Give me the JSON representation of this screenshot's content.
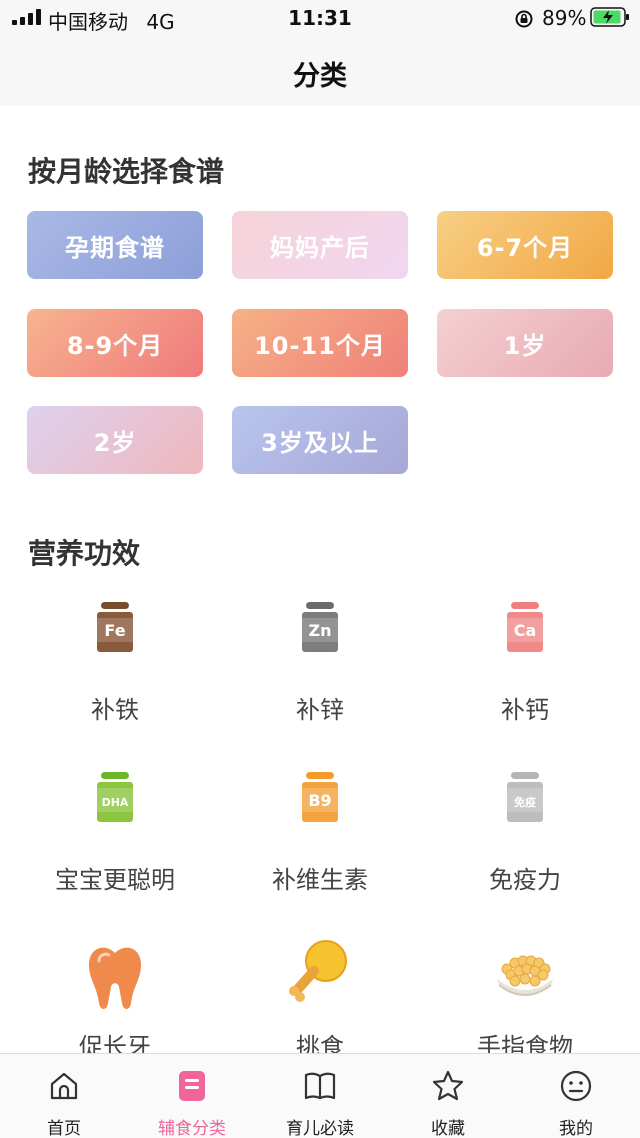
{
  "status_bar": {
    "carrier": "中国移动",
    "network": "4G",
    "time": "11:31",
    "battery": "89%"
  },
  "nav": {
    "title": "分类"
  },
  "age_section": {
    "title": "按月龄选择食谱",
    "items": [
      {
        "label": "孕期食谱",
        "gradient": [
          "#a9b8e6",
          "#8c9fd8"
        ]
      },
      {
        "label": "妈妈产后",
        "gradient": [
          "#f6d3d8",
          "#f1d6f0"
        ]
      },
      {
        "label": "6-7个月",
        "gradient": [
          "#f7cf85",
          "#f2a744"
        ]
      },
      {
        "label": "8-9个月",
        "gradient": [
          "#f7b48e",
          "#ef7a7c"
        ]
      },
      {
        "label": "10-11个月",
        "gradient": [
          "#f6b186",
          "#ef8179"
        ]
      },
      {
        "label": "1岁",
        "gradient": [
          "#f4d0d3",
          "#e8aab2"
        ]
      },
      {
        "label": "2岁",
        "gradient": [
          "#ded1ee",
          "#efb7bd"
        ]
      },
      {
        "label": "3岁及以上",
        "gradient": [
          "#b8c5ec",
          "#a7a7d8"
        ]
      }
    ]
  },
  "nutrition_section": {
    "title": "营养功效",
    "items": [
      {
        "label": "补铁",
        "icon": "iron-bottle-icon",
        "icon_text": "Fe",
        "color": "#8a5a3c",
        "cap": "#7a4b2c"
      },
      {
        "label": "补锌",
        "icon": "zinc-bottle-icon",
        "icon_text": "Zn",
        "color": "#7d7d7d",
        "cap": "#6a6a6a"
      },
      {
        "label": "补钙",
        "icon": "calcium-bottle-icon",
        "icon_text": "Ca",
        "color": "#f08a8a",
        "cap": "#f07f7f"
      },
      {
        "label": "宝宝更聪明",
        "icon": "dha-bottle-icon",
        "icon_text": "DHA",
        "color": "#8cc63f",
        "cap": "#6fb52c"
      },
      {
        "label": "补维生素",
        "icon": "vitamin-b9-bottle-icon",
        "icon_text": "B9",
        "color": "#f4a340",
        "cap": "#f39a2c"
      },
      {
        "label": "免疫力",
        "icon": "immunity-bottle-icon",
        "icon_text": "免疫",
        "color": "#bdbdbd",
        "cap": "#b5b5b5"
      },
      {
        "label": "促长牙",
        "icon": "tooth-icon",
        "icon_text": "",
        "color": "#f08a4c",
        "cap": ""
      },
      {
        "label": "挑食",
        "icon": "drumstick-icon",
        "icon_text": "",
        "color": "#f6c22f",
        "cap": ""
      },
      {
        "label": "手指食物",
        "icon": "finger-food-bowl-icon",
        "icon_text": "",
        "color": "#f5c869",
        "cap": ""
      }
    ]
  },
  "tab_bar": {
    "tabs": [
      {
        "label": "首页",
        "icon": "home-icon"
      },
      {
        "label": "辅食分类",
        "icon": "category-book-icon",
        "active": true
      },
      {
        "label": "育儿必读",
        "icon": "open-book-icon"
      },
      {
        "label": "收藏",
        "icon": "star-icon"
      },
      {
        "label": "我的",
        "icon": "smiley-face-icon"
      }
    ]
  }
}
